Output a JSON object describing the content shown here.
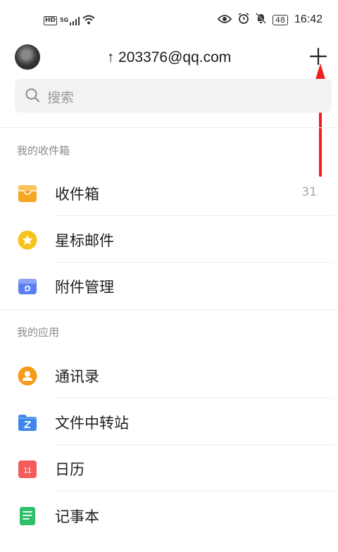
{
  "status_bar": {
    "hd_label": "HD",
    "network_label": "5G",
    "battery_level": "48",
    "time": "16:42"
  },
  "header": {
    "account": "↑     203376@qq.com",
    "add_icon": "plus-icon"
  },
  "search": {
    "placeholder": "搜索"
  },
  "mailboxes": {
    "title": "我的收件箱",
    "items": [
      {
        "label": "收件箱",
        "count": "31",
        "icon": "inbox-icon",
        "color": "#f5a623"
      },
      {
        "label": "星标邮件",
        "icon": "star-icon",
        "color": "#f7c21a"
      },
      {
        "label": "附件管理",
        "icon": "attachment-icon",
        "color": "#5b7ff2"
      }
    ]
  },
  "apps": {
    "title": "我的应用",
    "items": [
      {
        "label": "通讯录",
        "icon": "contacts-icon",
        "color": "#f59c1a"
      },
      {
        "label": "文件中转站",
        "icon": "folder-icon",
        "color": "#3e86ea"
      },
      {
        "label": "日历",
        "icon": "calendar-icon",
        "color": "#f25c5c",
        "badge": "11"
      },
      {
        "label": "记事本",
        "icon": "notebook-icon",
        "color": "#2fbf6a"
      }
    ]
  },
  "colors": {
    "accent_arrow": "#f01e1e",
    "divider": "#ececec"
  }
}
